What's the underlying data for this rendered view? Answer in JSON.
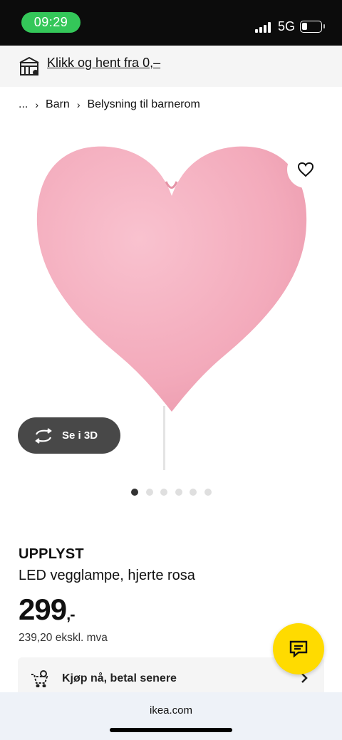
{
  "status_bar": {
    "time": "09:29",
    "network": "5G",
    "time_pill_color": "#34c759"
  },
  "promo": {
    "icon": "store-pickup-icon",
    "link_text": "Klikk og hent fra 0,–"
  },
  "breadcrumb": {
    "items": [
      "...",
      "Barn",
      "Belysning til barnerom"
    ],
    "separator_icon": "chevron-right-icon"
  },
  "gallery": {
    "image": "pink-heart-wall-lamp",
    "favorite_icon": "heart-outline-icon",
    "view_3d_label": "Se i 3D",
    "view_3d_icon": "rotate-3d-icon",
    "slide_count": 6,
    "active_slide": 1
  },
  "product": {
    "name": "UPPLYST",
    "description": "LED vegglampe, hjerte rosa",
    "price_main": "299",
    "price_suffix": ",-",
    "price_excl_vat": "239,20 ekskl. mva"
  },
  "bnpl": {
    "icon": "cart-clock-icon",
    "label": "Kjøp nå, betal senere",
    "chevron_icon": "chevron-right-icon"
  },
  "chat": {
    "icon": "chat-bubble-icon",
    "color": "#ffdb00"
  },
  "browser": {
    "url": "ikea.com"
  }
}
